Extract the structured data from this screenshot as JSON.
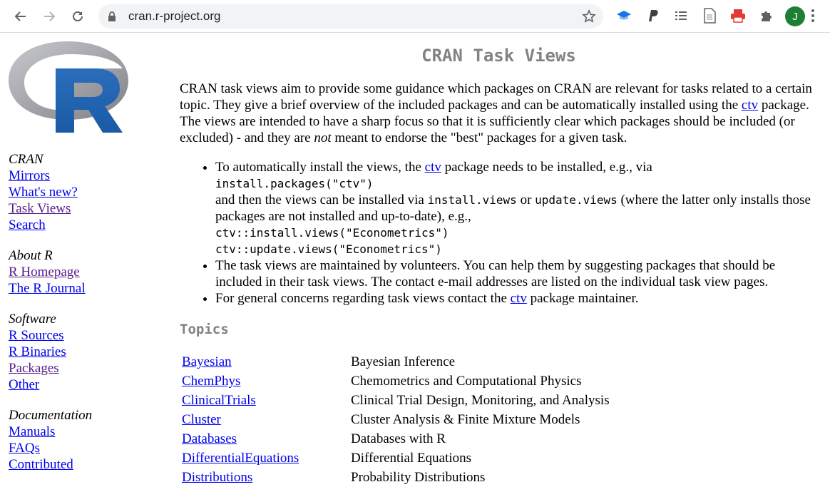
{
  "browser": {
    "url": "cran.r-project.org",
    "profile_initial": "J",
    "icons": [
      "back-icon",
      "forward-icon",
      "reload-icon",
      "lock-icon",
      "star-icon",
      "mortarboard-icon",
      "paypal-icon",
      "reading-list-icon",
      "document-icon",
      "printer-icon",
      "puzzle-icon",
      "menu-dots-icon"
    ]
  },
  "sidebar": {
    "groups": [
      {
        "heading": "CRAN",
        "links": [
          "Mirrors",
          "What's new?",
          "Task Views",
          "Search"
        ]
      },
      {
        "heading": "About R",
        "links": [
          "R Homepage",
          "The R Journal"
        ]
      },
      {
        "heading": "Software",
        "links": [
          "R Sources",
          "R Binaries",
          "Packages",
          "Other"
        ]
      },
      {
        "heading": "Documentation",
        "links": [
          "Manuals",
          "FAQs",
          "Contributed"
        ]
      }
    ]
  },
  "main": {
    "title": "CRAN Task Views",
    "intro": {
      "p1": "CRAN task views aim to provide some guidance which packages on CRAN are relevant for tasks related to a certain topic. They give a brief overview of the included packages and can be automatically installed using the ",
      "ctv": "ctv",
      "p2": " package. The views are intended to have a sharp focus so that it is sufficiently clear which packages should be included (or excluded) - and they are ",
      "not": "not",
      "p3": " meant to endorse the \"best\" packages for a given task."
    },
    "bullets": {
      "b1_a": "To automatically install the views, the ",
      "b1_b": " package needs to be installed, e.g., via",
      "code1": "install.packages(\"ctv\")",
      "b1_c": "and then the views can be installed via ",
      "code_install": "install.views",
      "b1_or": " or ",
      "code_update": "update.views",
      "b1_d": " (where the latter only installs those packages are not installed and up-to-date), e.g.,",
      "code2": "ctv::install.views(\"Econometrics\")",
      "code3": "ctv::update.views(\"Econometrics\")",
      "b2": "The task views are maintained by volunteers. You can help them by suggesting packages that should be included in their task views. The contact e-mail addresses are listed on the individual task view pages.",
      "b3_a": "For general concerns regarding task views contact the ",
      "b3_b": " package maintainer."
    },
    "topics_heading": "Topics",
    "topics": [
      {
        "name": "Bayesian",
        "desc": "Bayesian Inference"
      },
      {
        "name": "ChemPhys",
        "desc": "Chemometrics and Computational Physics"
      },
      {
        "name": "ClinicalTrials",
        "desc": "Clinical Trial Design, Monitoring, and Analysis"
      },
      {
        "name": "Cluster",
        "desc": "Cluster Analysis & Finite Mixture Models"
      },
      {
        "name": "Databases",
        "desc": "Databases with R"
      },
      {
        "name": "DifferentialEquations",
        "desc": "Differential Equations"
      },
      {
        "name": "Distributions",
        "desc": "Probability Distributions"
      }
    ]
  }
}
